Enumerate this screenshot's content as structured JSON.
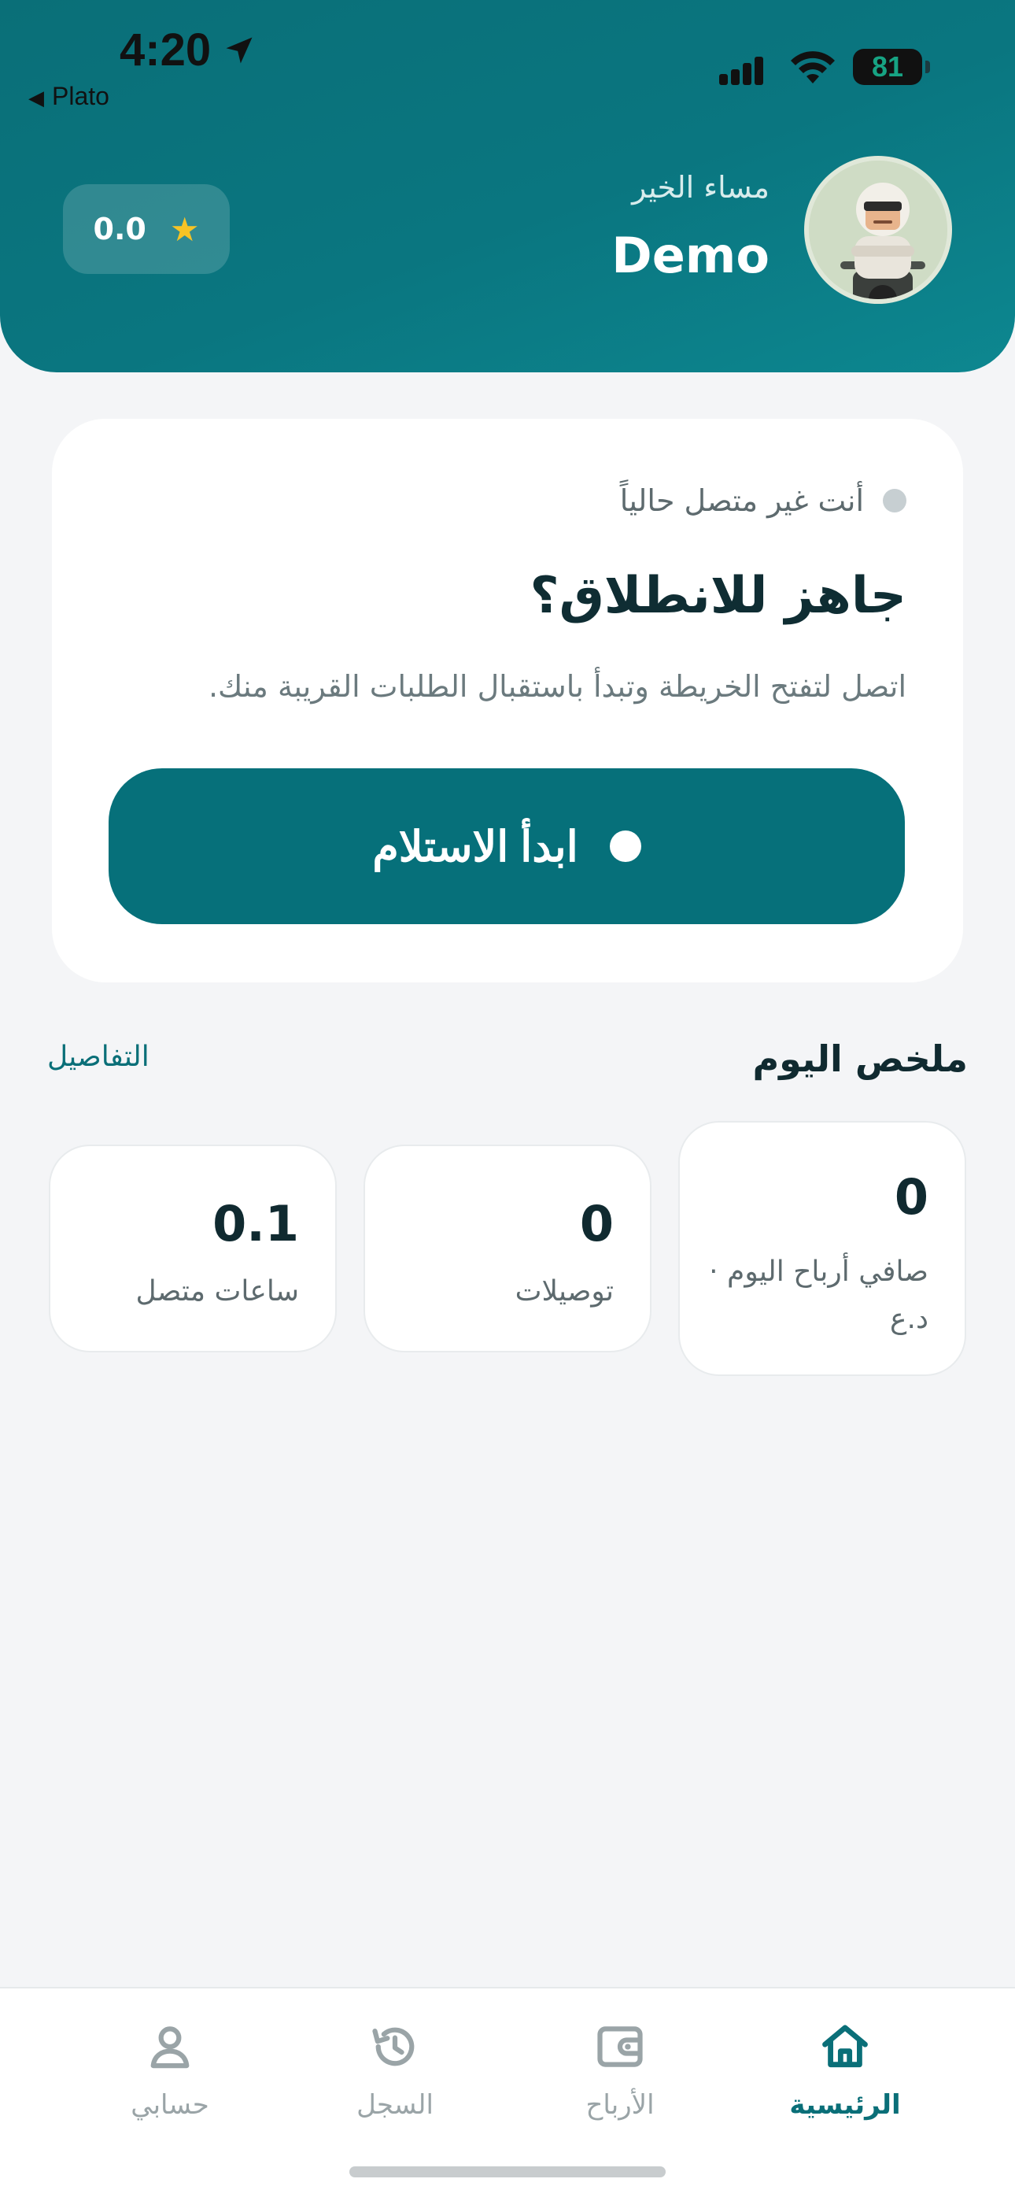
{
  "status_bar": {
    "time": "4:20",
    "back_app": "Plato",
    "battery": "81"
  },
  "header": {
    "rating": "0.0",
    "greeting": "مساء الخير",
    "user_name": "Demo"
  },
  "status_card": {
    "offline_text": "أنت غير متصل حالياً",
    "title": "جاهز للانطلاق؟",
    "subtitle": "اتصل لتفتح الخريطة وتبدأ باستقبال الطلبات القريبة منك.",
    "button_label": "ابدأ الاستلام"
  },
  "summary": {
    "title": "ملخص اليوم",
    "details_link": "التفاصيل",
    "stats": [
      {
        "value": "0",
        "label": "صافي أرباح اليوم · د.ع"
      },
      {
        "value": "0",
        "label": "توصيلات"
      },
      {
        "value": "0.1",
        "label": "ساعات متصل"
      }
    ]
  },
  "bottom_nav": {
    "home": "الرئيسية",
    "earnings": "الأرباح",
    "history": "السجل",
    "account": "حسابي"
  },
  "colors": {
    "primary": "#0a6f78",
    "star": "#f7c325",
    "background": "#f4f5f7"
  }
}
